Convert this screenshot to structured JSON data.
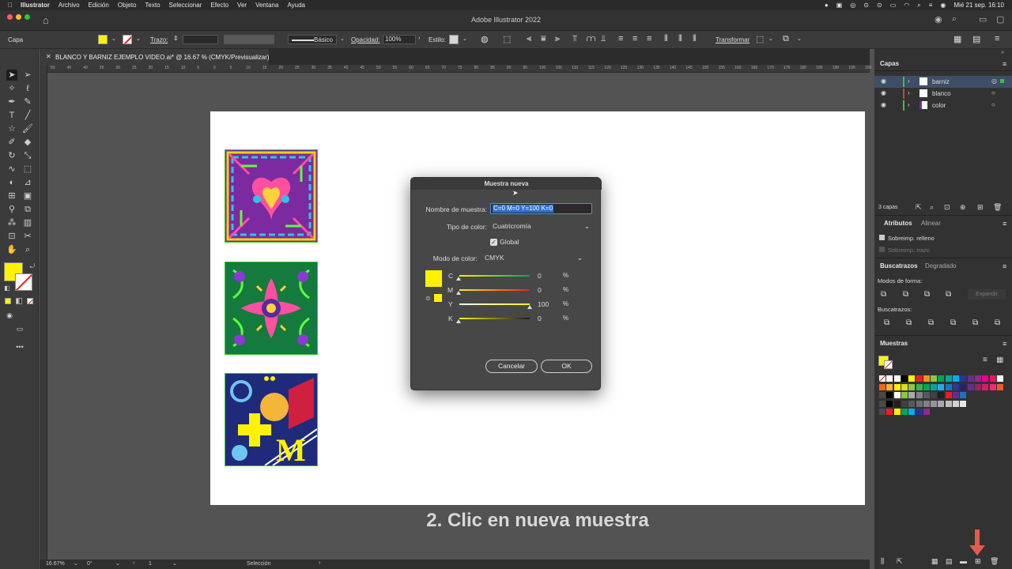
{
  "menubar": {
    "app": "Illustrator",
    "items": [
      "Archivo",
      "Edición",
      "Objeto",
      "Texto",
      "Seleccionar",
      "Efecto",
      "Ver",
      "Ventana",
      "Ayuda"
    ],
    "clock": "Mié 21 sep.  16:10"
  },
  "window": {
    "title": "Adobe Illustrator 2022"
  },
  "control_bar": {
    "selection_label": "Capa",
    "stroke_label": "Trazo:",
    "brush_label": "Básico",
    "opacity_label": "Opacidad:",
    "opacity_value": "100%",
    "style_label": "Estilo:",
    "transform_label": "Transformar"
  },
  "document": {
    "tab_title": "BLANCO Y BARNIZ EJEMPLO VIDEO.ai* @ 16.67 % (CMYK/Previsualizar)",
    "ruler_labels": [
      "50",
      "45",
      "40",
      "35",
      "30",
      "25",
      "20",
      "15",
      "10",
      "5",
      "0",
      "5",
      "10",
      "15",
      "20",
      "25",
      "30",
      "35",
      "40",
      "45",
      "50",
      "55",
      "60",
      "65",
      "70",
      "75",
      "80",
      "85",
      "90",
      "95",
      "100",
      "105",
      "110",
      "115",
      "120",
      "125",
      "130",
      "135",
      "140",
      "145",
      "150",
      "155",
      "160",
      "165",
      "170",
      "175",
      "180",
      "185",
      "190",
      "195",
      "200"
    ]
  },
  "status_bar": {
    "zoom": "16.67%",
    "rotation": "0°",
    "artboard": "1",
    "tool": "Selección"
  },
  "dialog": {
    "title": "Muestra nueva",
    "name_label": "Nombre de muestra:",
    "name_value": "C=0 M=0 Y=100 K=0",
    "type_label": "Tipo de color:",
    "type_value": "Cuatricromía",
    "global_label": "Global",
    "mode_label": "Modo de color:",
    "mode_value": "CMYK",
    "channels": [
      {
        "label": "C",
        "value": "0",
        "unit": "%"
      },
      {
        "label": "M",
        "value": "0",
        "unit": "%"
      },
      {
        "label": "Y",
        "value": "100",
        "unit": "%"
      },
      {
        "label": "K",
        "value": "0",
        "unit": "%"
      }
    ],
    "cancel_label": "Cancelar",
    "ok_label": "OK",
    "swatch_color": "#fff200"
  },
  "caption": "2. Clic en nueva muestra",
  "layers_panel": {
    "title": "Capas",
    "layers": [
      {
        "name": "barniz",
        "color": "#3ac43a"
      },
      {
        "name": "blanco",
        "color": "#d23a3a"
      },
      {
        "name": "color",
        "color": "#3ac43a"
      }
    ],
    "count": "3 capas"
  },
  "attributes_panel": {
    "tabs": [
      "Atributos",
      "Alinear"
    ],
    "overprint_fill": "Sobreimp. relleno",
    "overprint_stroke": "Sobreimp. trazo"
  },
  "pathfinder_panel": {
    "tabs": [
      "Buscatrazos",
      "Degradado"
    ],
    "shape_modes": "Modos de forma:",
    "expand": "Expandir",
    "pathfinders": "Buscatrazos:"
  },
  "swatches_panel": {
    "title": "Muestras"
  },
  "colors": {
    "fill": "#fff200",
    "accent": "#2f6fd6",
    "arrow": "#e35a4e"
  }
}
